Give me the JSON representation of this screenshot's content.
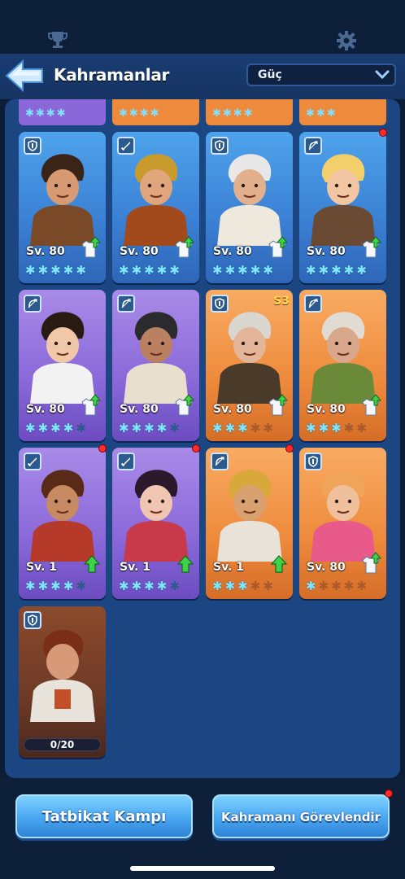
{
  "header": {
    "title": "Kahramanlar",
    "sort_value": "Güç",
    "icons": [
      "trophy-icon",
      "gear-icon",
      "back-arrow-icon",
      "chevron-down-icon"
    ]
  },
  "heroes": [
    {
      "level": "Sv. 80",
      "role": "tank",
      "rarity": "blue",
      "stars_on": 5,
      "stars_total": 5,
      "gear_upgrade": true,
      "notification": false
    },
    {
      "level": "Sv. 80",
      "role": "sword",
      "rarity": "blue",
      "stars_on": 5,
      "stars_total": 5,
      "gear_upgrade": true,
      "notification": false
    },
    {
      "level": "Sv. 80",
      "role": "tank",
      "rarity": "blue",
      "stars_on": 5,
      "stars_total": 5,
      "gear_upgrade": true,
      "notification": false
    },
    {
      "level": "Sv. 80",
      "role": "bow",
      "rarity": "blue",
      "stars_on": 5,
      "stars_total": 5,
      "gear_upgrade": true,
      "notification": true
    },
    {
      "level": "Sv. 80",
      "role": "bow",
      "rarity": "purple",
      "stars_on": 4,
      "stars_total": 5,
      "gear_upgrade": true,
      "notification": false
    },
    {
      "level": "Sv. 80",
      "role": "bow",
      "rarity": "purple",
      "stars_on": 4,
      "stars_total": 5,
      "gear_upgrade": true,
      "notification": false
    },
    {
      "level": "Sv. 80",
      "role": "tank",
      "rarity": "orange",
      "stars_on": 3,
      "stars_total": 5,
      "gear_upgrade": true,
      "notification": false,
      "season": "S3"
    },
    {
      "level": "Sv. 80",
      "role": "bow",
      "rarity": "orange",
      "stars_on": 3,
      "stars_total": 5,
      "gear_upgrade": true,
      "notification": false
    },
    {
      "level": "Sv. 1",
      "role": "sword",
      "rarity": "purple",
      "stars_on": 4,
      "stars_total": 5,
      "gear_upgrade": false,
      "notification": true
    },
    {
      "level": "Sv. 1",
      "role": "sword",
      "rarity": "purple",
      "stars_on": 4,
      "stars_total": 5,
      "gear_upgrade": false,
      "notification": true
    },
    {
      "level": "Sv. 1",
      "role": "bow",
      "rarity": "orange",
      "stars_on": 3,
      "stars_total": 5,
      "gear_upgrade": false,
      "notification": true
    },
    {
      "level": "Sv. 80",
      "role": "tank",
      "rarity": "orange",
      "stars_on": 1,
      "stars_total": 5,
      "gear_upgrade": true,
      "notification": false
    }
  ],
  "locked_hero": {
    "role": "tank",
    "progress": "0/20"
  },
  "buttons": {
    "training_camp": "Tatbikat Kampı",
    "assign_hero": "Kahramanı Görevlendir"
  },
  "colors": {
    "blue_card": "#3a7fd3",
    "purple_card": "#8a68d9",
    "orange_card": "#ee8a3c",
    "star_active": "#7fe6ff",
    "notification": "#ff2b2b"
  }
}
